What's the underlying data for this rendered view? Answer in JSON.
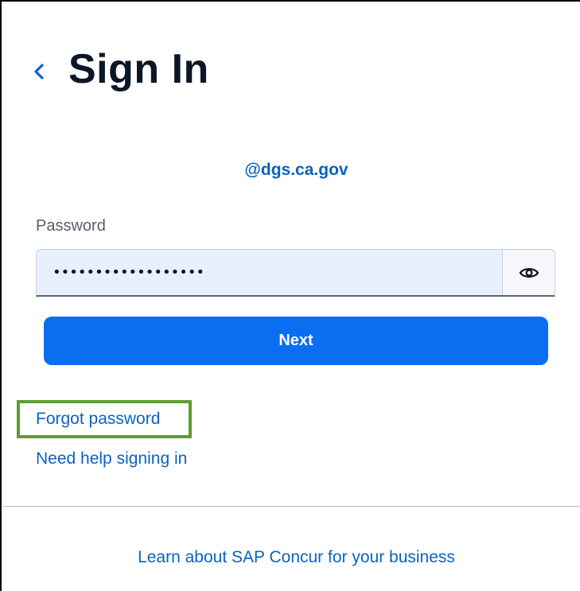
{
  "header": {
    "back_icon": "chevron-left-icon",
    "title": "Sign In"
  },
  "account": {
    "email": "@dgs.ca.gov"
  },
  "password": {
    "label": "Password",
    "value": "••••••••••••••••••",
    "toggle_icon": "eye-icon"
  },
  "actions": {
    "next_label": "Next"
  },
  "links": {
    "forgot_password": "Forgot password",
    "need_help": "Need help signing in",
    "learn_more": "Learn about SAP Concur for your business"
  },
  "colors": {
    "accent": "#0a6ef0",
    "link": "#0a63c2",
    "title": "#0b1726",
    "highlight": "#5aa02c",
    "field_bg": "#e8f0fe"
  }
}
